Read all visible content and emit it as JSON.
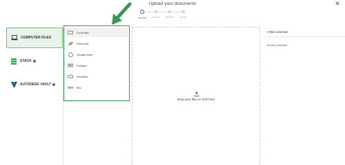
{
  "header": {
    "title": "Upload your documents"
  },
  "stepper": {
    "steps": [
      "UPLOAD",
      "DETAILS",
      "REVIEW",
      "SELECT"
    ],
    "active_index": 0
  },
  "sources": [
    {
      "label": "COMPUTER FILES",
      "icon": "laptop-icon",
      "active": true,
      "info": false
    },
    {
      "label": "STACK",
      "icon": "stack-logo-icon",
      "active": false,
      "info": true
    },
    {
      "label": "AUTODESK VAULT",
      "icon": "autodesk-vault-icon",
      "active": false,
      "info": true
    }
  ],
  "file_options": [
    {
      "label": "Local files",
      "icon": "folder-icon",
      "active": true
    },
    {
      "label": "Direct link",
      "icon": "link-icon",
      "active": false
    },
    {
      "label": "Google Drive",
      "icon": "google-drive-icon",
      "active": false
    },
    {
      "label": "Dropbox",
      "icon": "dropbox-icon",
      "active": false
    },
    {
      "label": "Onedrive",
      "icon": "onedrive-icon",
      "active": false
    },
    {
      "label": "Box",
      "icon": "box-icon",
      "active": false
    }
  ],
  "dropzone": {
    "text": "Drop your files or click here",
    "icon": "upload-icon"
  },
  "selection": {
    "count_label": "0 files selected",
    "empty_label": "No files selected"
  },
  "colors": {
    "highlight_green": "#2e9b4f",
    "active_tab_bg": "#eaf3ea",
    "active_tab_border": "#7db389"
  }
}
